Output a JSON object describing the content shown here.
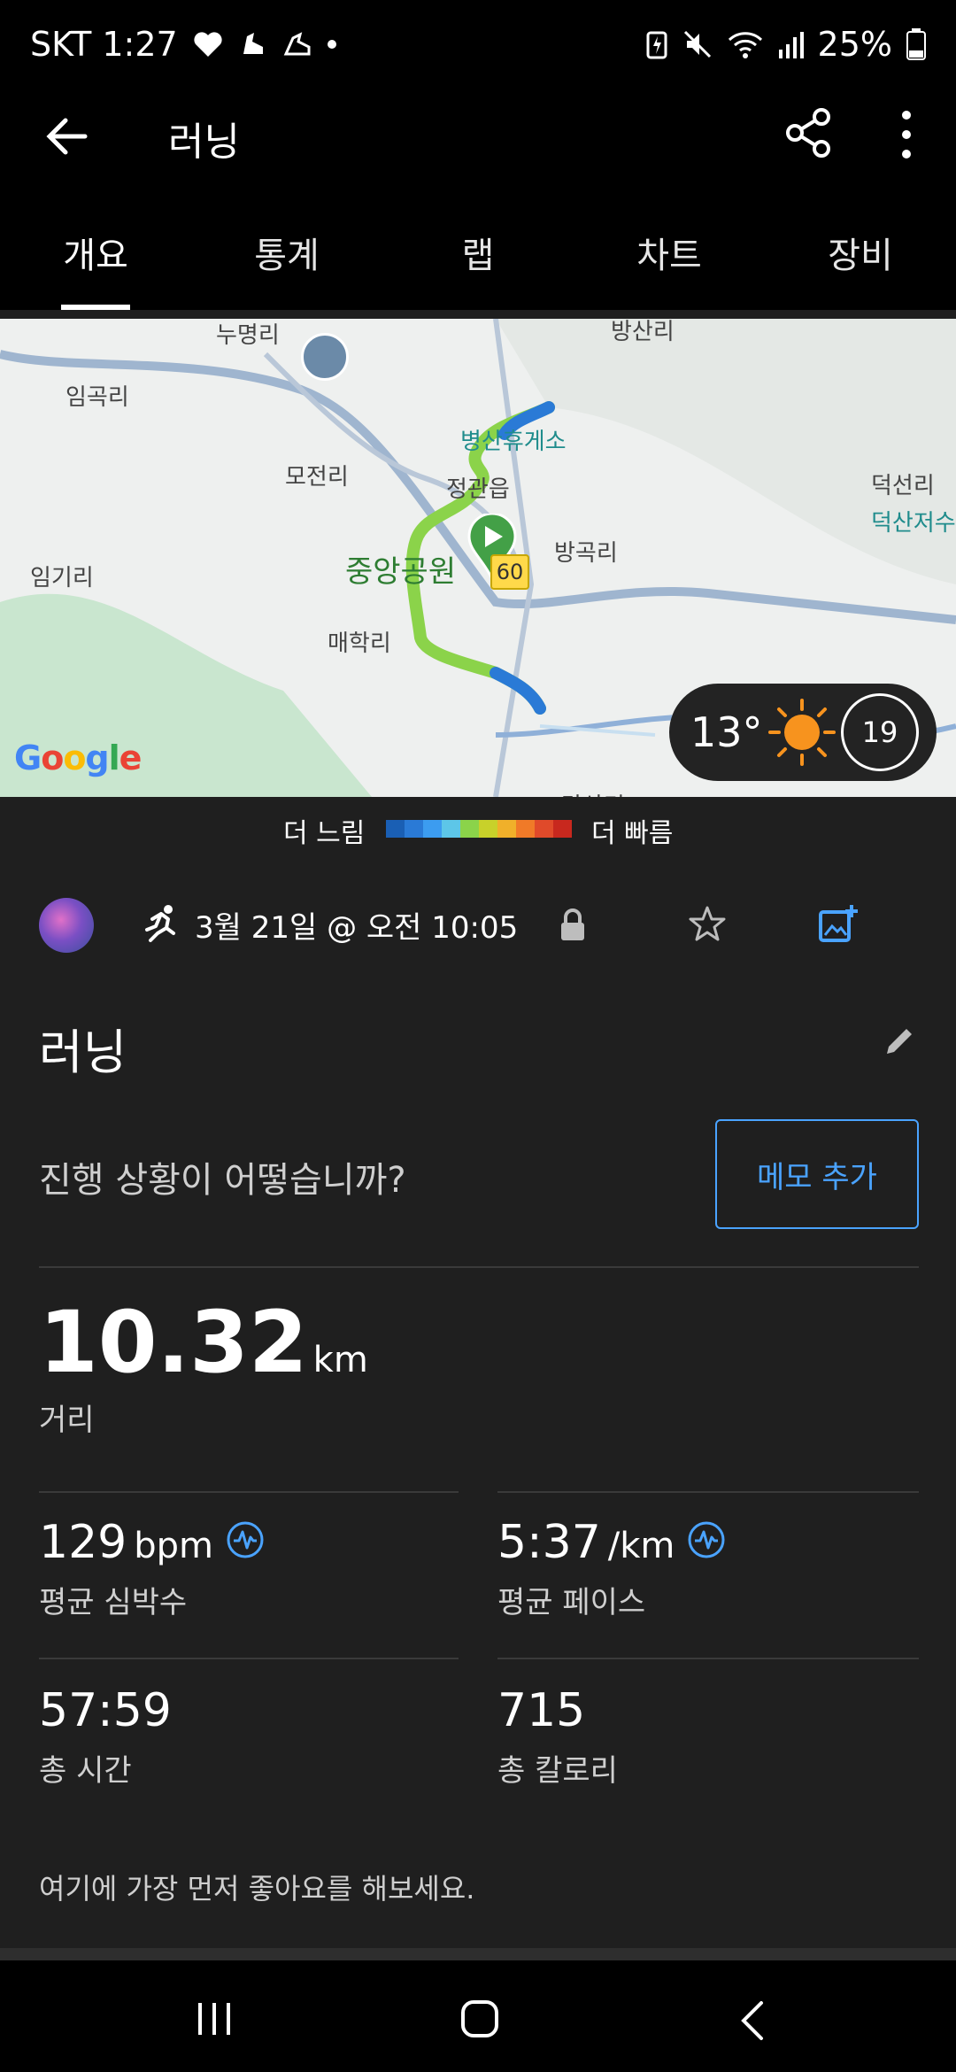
{
  "status_bar": {
    "carrier_time": "SKT 1:27",
    "battery": "25%",
    "icons": [
      "heart-icon",
      "shoe-icon",
      "shoe2-icon",
      "dot-icon",
      "battery-saver-icon",
      "mute-icon",
      "wifi-icon",
      "signal-icon",
      "battery-icon"
    ]
  },
  "app_bar": {
    "title": "러닝",
    "icons": [
      "back-arrow-icon",
      "share-icon",
      "more-vert-icon"
    ]
  },
  "tabs": [
    {
      "label": "개요",
      "active": true
    },
    {
      "label": "통계",
      "active": false
    },
    {
      "label": "랩",
      "active": false
    },
    {
      "label": "차트",
      "active": false
    },
    {
      "label": "장비",
      "active": false
    }
  ],
  "map": {
    "labels": [
      "누명리",
      "임곡리",
      "병산휴게소",
      "모전리",
      "정관읍",
      "덕선리",
      "덕산저수",
      "방곡리",
      "중앙공원",
      "임기리",
      "매학리",
      "당산리",
      "방산리"
    ],
    "road_number": "60",
    "google_logo": "Google",
    "weather_temp": "13°",
    "weather_icon": "sun-icon",
    "uv_index": "19"
  },
  "pace_legend": {
    "slow": "더 느림",
    "fast": "더 빠름",
    "colors": [
      "#1a5fb4",
      "#2a7ad6",
      "#3c9cf0",
      "#5dc6e8",
      "#8bd34a",
      "#c8d12a",
      "#f0b02a",
      "#f07a28",
      "#e04a2a",
      "#c8281e"
    ]
  },
  "activity": {
    "type_icon": "running-icon",
    "datetime": "3월 21일 @ 오전 10:05",
    "title": "러닝",
    "prompt": "진행 상황이 어떻습니까?",
    "memo_button": "메모 추가"
  },
  "distance": {
    "value": "10.32",
    "unit": "km",
    "label": "거리"
  },
  "stats": {
    "heart_rate": {
      "value": "129",
      "unit": "bpm",
      "label": "평균 심박수"
    },
    "pace": {
      "value": "5:37",
      "unit": "/km",
      "label": "평균 페이스"
    },
    "time": {
      "value": "57:59",
      "label": "총 시간"
    },
    "calories": {
      "value": "715",
      "label": "총 칼로리"
    }
  },
  "like_prompt": "여기에 가장 먼저 좋아요를 해보세요.",
  "colors": {
    "accent": "#4aa3ff",
    "background": "#1f1f1f",
    "bar": "#000000"
  }
}
